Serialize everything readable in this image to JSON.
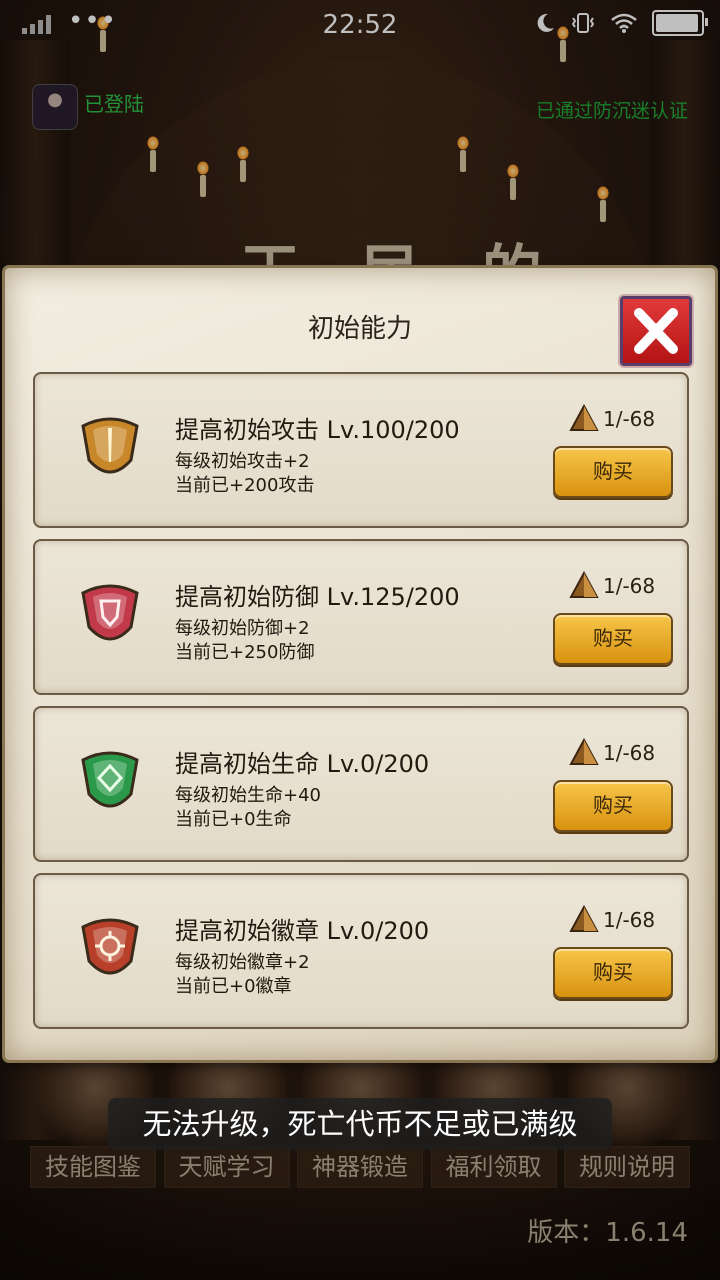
{
  "status_bar": {
    "time": "22:52",
    "battery_level": 0.95
  },
  "user": {
    "login_status": "已登陆",
    "login_sub": "…",
    "anti_addiction": "已通过防沉迷认证"
  },
  "dialog": {
    "title": "初始能力",
    "items": [
      {
        "title": "提高初始攻击 Lv.100/200",
        "desc": "每级初始攻击+2",
        "current": "当前已+200攻击",
        "cost": "1/-68",
        "buy_label": "购买",
        "gem": "attack-gem-icon",
        "gem_color": "#c8882a"
      },
      {
        "title": "提高初始防御 Lv.125/200",
        "desc": "每级初始防御+2",
        "current": "当前已+250防御",
        "cost": "1/-68",
        "buy_label": "购买",
        "gem": "defense-gem-icon",
        "gem_color": "#c23a4a"
      },
      {
        "title": "提高初始生命 Lv.0/200",
        "desc": "每级初始生命+40",
        "current": "当前已+0生命",
        "cost": "1/-68",
        "buy_label": "购买",
        "gem": "life-gem-icon",
        "gem_color": "#2a9a4a"
      },
      {
        "title": "提高初始徽章 Lv.0/200",
        "desc": "每级初始徽章+2",
        "current": "当前已+0徽章",
        "cost": "1/-68",
        "buy_label": "购买",
        "gem": "badge-gem-icon",
        "gem_color": "#b8402a"
      }
    ]
  },
  "toast": "无法升级，死亡代币不足或已满级",
  "menu": [
    "技能图鉴",
    "天赋学习",
    "神器锻造",
    "福利领取",
    "规则说明"
  ],
  "version": "版本：1.6.14"
}
